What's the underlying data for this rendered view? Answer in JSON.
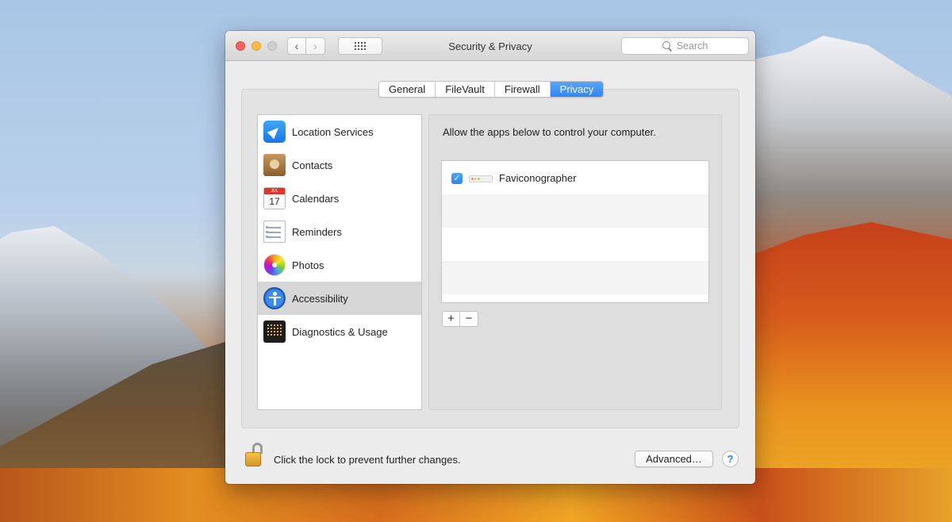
{
  "window": {
    "title": "Security & Privacy",
    "search_placeholder": "Search"
  },
  "tabs": [
    {
      "label": "General",
      "active": false
    },
    {
      "label": "FileVault",
      "active": false
    },
    {
      "label": "Firewall",
      "active": false
    },
    {
      "label": "Privacy",
      "active": true
    }
  ],
  "categories": [
    {
      "label": "Location Services",
      "icon": "location-arrow-icon"
    },
    {
      "label": "Contacts",
      "icon": "contacts-book-icon"
    },
    {
      "label": "Calendars",
      "icon": "calendar-icon",
      "icon_month": "JUL",
      "icon_day": "17"
    },
    {
      "label": "Reminders",
      "icon": "reminders-list-icon"
    },
    {
      "label": "Photos",
      "icon": "photos-flower-icon"
    },
    {
      "label": "Accessibility",
      "icon": "accessibility-icon",
      "selected": true
    },
    {
      "label": "Diagnostics & Usage",
      "icon": "diagnostics-grid-icon"
    }
  ],
  "detail": {
    "description": "Allow the apps below to control your computer.",
    "apps": [
      {
        "name": "Faviconographer",
        "checked": true,
        "check_glyph": "✓"
      }
    ],
    "add_label": "+",
    "remove_label": "−"
  },
  "footer": {
    "lock_text": "Click the lock to prevent further changes.",
    "advanced_label": "Advanced…",
    "help_label": "?"
  },
  "colors": {
    "accent": "#2f86f6",
    "close": "#fc605c",
    "minimize": "#fdbc40"
  }
}
